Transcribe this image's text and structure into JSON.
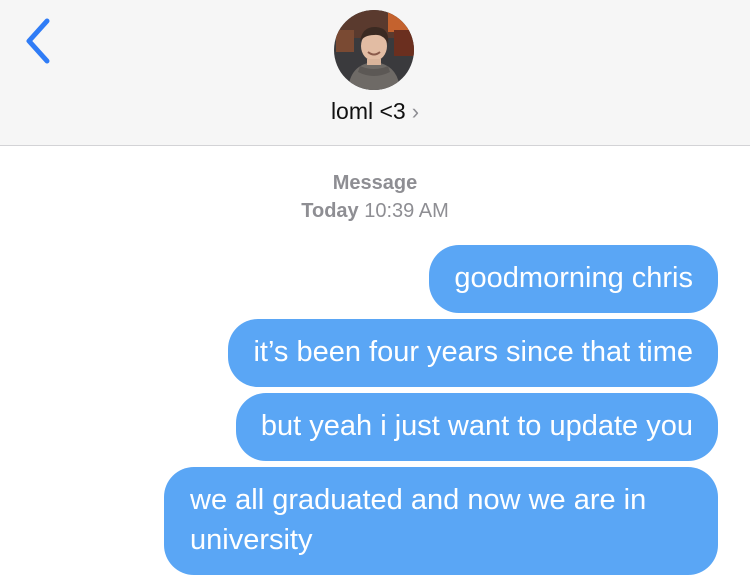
{
  "header": {
    "contact_name": "loml <3",
    "chevron": "›",
    "back_icon": "chevron-left-icon",
    "avatar_icon": "avatar"
  },
  "thread": {
    "service": "Message",
    "day": "Today",
    "time": "10:39 AM"
  },
  "messages": [
    {
      "text": "goodmorning chris",
      "sender": "me"
    },
    {
      "text": "it’s been four years since that time",
      "sender": "me"
    },
    {
      "text": "but yeah i just want to update you",
      "sender": "me"
    },
    {
      "text": "we all graduated and now we are in university",
      "sender": "me"
    }
  ],
  "colors": {
    "bubble": "#5aa6f5",
    "accent": "#2f7cf6",
    "meta": "#8e8e93",
    "header_bg": "#f6f6f6"
  }
}
